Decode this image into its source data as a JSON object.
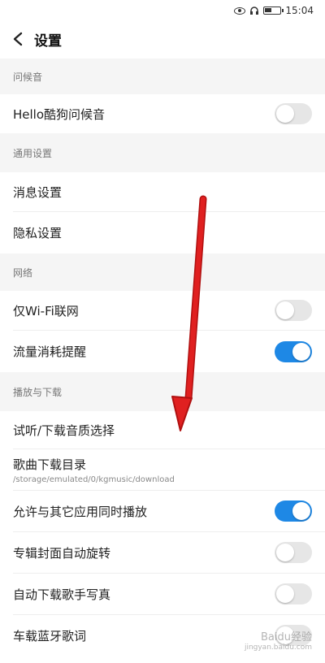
{
  "status_bar": {
    "time": "15:04"
  },
  "header": {
    "title": "设置"
  },
  "sections": [
    {
      "title": "问候音"
    },
    {
      "title": "通用设置"
    },
    {
      "title": "网络"
    },
    {
      "title": "播放与下载"
    }
  ],
  "rows": [
    {
      "label": "Hello酷狗问候音",
      "toggle": false
    },
    {
      "label": "消息设置"
    },
    {
      "label": "隐私设置"
    },
    {
      "label": "仅Wi-Fi联网",
      "toggle": false
    },
    {
      "label": "流量消耗提醒",
      "toggle": true
    },
    {
      "label": "试听/下载音质选择"
    },
    {
      "label": "歌曲下载目录",
      "subtitle": "/storage/emulated/0/kgmusic/download"
    },
    {
      "label": "允许与其它应用同时播放",
      "toggle": true
    },
    {
      "label": "专辑封面自动旋转",
      "toggle": false
    },
    {
      "label": "自动下载歌手写真",
      "toggle": false
    },
    {
      "label": "车载蓝牙歌词",
      "toggle": false
    }
  ],
  "colors": {
    "toggle_on": "#1e88e5",
    "arrow": "#e02020"
  },
  "watermark": {
    "text": "Baidu经验",
    "sub": "jingyan.baidu.com"
  }
}
